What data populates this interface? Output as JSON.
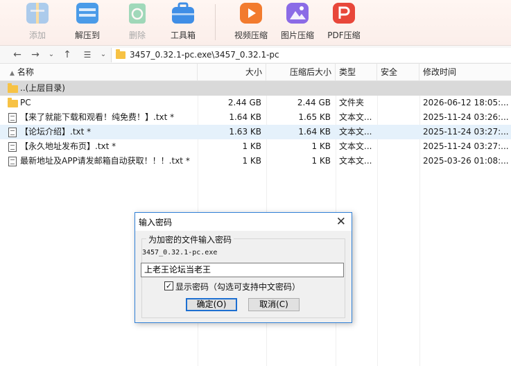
{
  "toolbar": {
    "items": [
      {
        "label": "添加",
        "icon": "add-archive-icon",
        "disabled": true,
        "color": "#4a9be8"
      },
      {
        "label": "解压到",
        "icon": "extract-to-icon",
        "disabled": false,
        "color": "#4a9be8"
      },
      {
        "label": "删除",
        "icon": "recycle-icon",
        "disabled": true,
        "color": "#2fb879"
      },
      {
        "label": "工具箱",
        "icon": "toolbox-icon",
        "disabled": false,
        "color": "#3f8ee6"
      },
      {
        "label": "视频压缩",
        "icon": "video-compress-icon",
        "disabled": false,
        "color": "#f27b2e"
      },
      {
        "label": "图片压缩",
        "icon": "image-compress-icon",
        "disabled": false,
        "color": "#8b6be6"
      },
      {
        "label": "PDF压缩",
        "icon": "pdf-compress-icon",
        "disabled": false,
        "color": "#e8473a"
      }
    ]
  },
  "nav": {
    "back_icon": "arrow-left-icon",
    "forward_icon": "arrow-right-icon",
    "history_icon": "chevron-down-icon",
    "up_icon": "arrow-up-icon",
    "view_icon": "list-view-icon",
    "path": "3457_0.32.1-pc.exe\\3457_0.32.1-pc"
  },
  "columns": {
    "name": "名称",
    "size": "大小",
    "packed": "压缩后大小",
    "type": "类型",
    "security": "安全",
    "modified": "修改时间"
  },
  "files": [
    {
      "name": "..(上层目录)",
      "size": "",
      "packed": "",
      "type": "",
      "modified": "",
      "icon": "folder-icon"
    },
    {
      "name": "PC",
      "size": "2.44 GB",
      "packed": "2.44 GB",
      "type": "文件夹",
      "modified": "2026-06-12 18:05:...",
      "icon": "folder-icon"
    },
    {
      "name": "【来了就能下载和观看！纯免费！】.txt *",
      "size": "1.64 KB",
      "packed": "1.65 KB",
      "type": "文本文...",
      "modified": "2025-11-24 03:26:...",
      "icon": "text-file-icon"
    },
    {
      "name": "【论坛介绍】.txt *",
      "size": "1.63 KB",
      "packed": "1.64 KB",
      "type": "文本文...",
      "modified": "2025-11-24 03:27:...",
      "icon": "text-file-icon"
    },
    {
      "name": "【永久地址发布页】.txt *",
      "size": "1 KB",
      "packed": "1 KB",
      "type": "文本文...",
      "modified": "2025-11-24 03:27:...",
      "icon": "text-file-icon"
    },
    {
      "name": "最新地址及APP请发邮箱自动获取！！！.txt *",
      "size": "1 KB",
      "packed": "1 KB",
      "type": "文本文...",
      "modified": "2025-03-26 01:08:...",
      "icon": "text-file-icon"
    }
  ],
  "dialog": {
    "title": "输入密码",
    "group_label": "为加密的文件输入密码",
    "filename": "3457_0.32.1-pc.exe",
    "password_value": "上老王论坛当老王",
    "show_password_checked": true,
    "show_password_label": "显示密码（勾选可支持中文密码）",
    "ok_label": "确定(O)",
    "cancel_label": "取消(C)"
  }
}
